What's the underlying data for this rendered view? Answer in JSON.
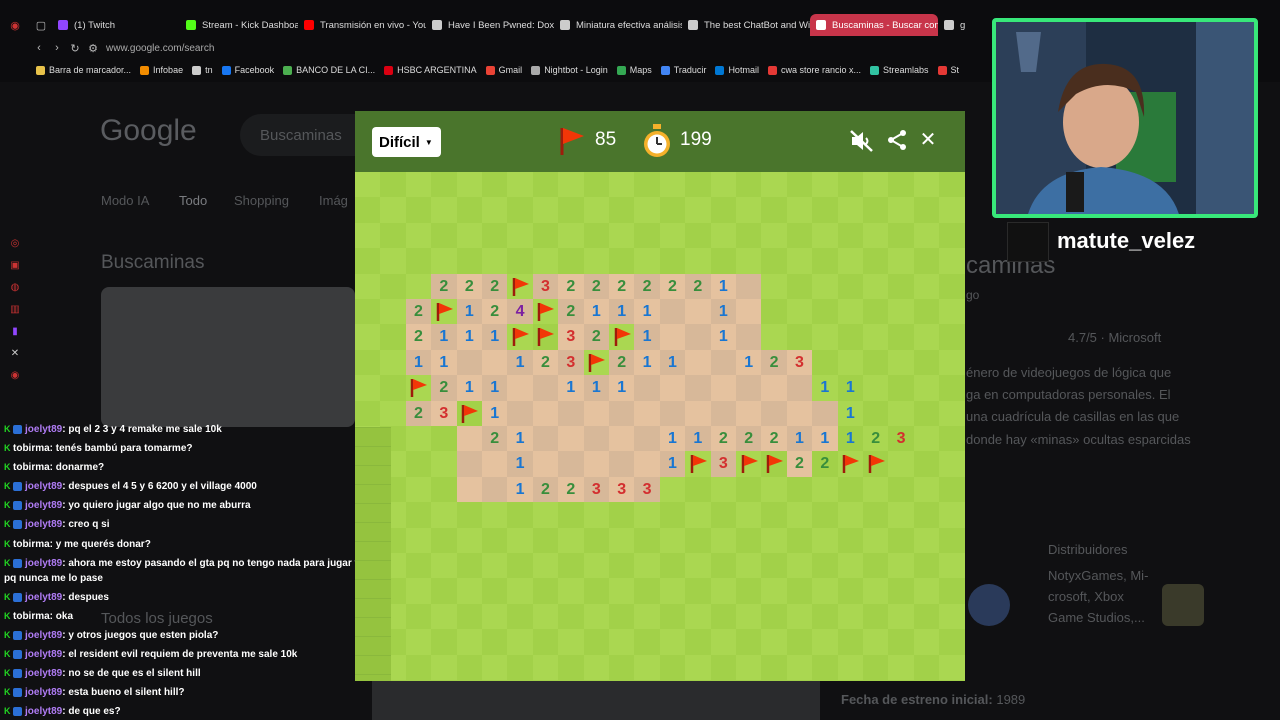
{
  "browser": {
    "tabs": [
      {
        "label": "(1) Twitch",
        "color": "#9146ff"
      },
      {
        "label": "Stream - Kick Dashboard",
        "color": "#53fc18"
      },
      {
        "label": "Transmisión en vivo - You",
        "color": "#ff0000"
      },
      {
        "label": "Have I Been Pwned: Doxb",
        "color": "#cccccc"
      },
      {
        "label": "Miniatura efectiva análisis",
        "color": "#cccccc"
      },
      {
        "label": "The best ChatBot and Wil",
        "color": "#cccccc"
      },
      {
        "label": "Buscaminas - Buscar con",
        "color": "#ffffff",
        "active": true
      },
      {
        "label": "g",
        "color": "#cccccc"
      }
    ],
    "url": "www.google.com/search",
    "bookmarks": [
      {
        "label": "Barra de marcador...",
        "color": "#e8c24a"
      },
      {
        "label": "Infobae",
        "color": "#f28c00"
      },
      {
        "label": "tn",
        "color": "#cccccc"
      },
      {
        "label": "Facebook",
        "color": "#1877f2"
      },
      {
        "label": "BANCO DE LA CI...",
        "color": "#4caf50"
      },
      {
        "label": "HSBC ARGENTINA",
        "color": "#db0011"
      },
      {
        "label": "Gmail",
        "color": "#ea4335"
      },
      {
        "label": "Nightbot - Login",
        "color": "#aaaaaa"
      },
      {
        "label": "Maps",
        "color": "#34a853"
      },
      {
        "label": "Traducir",
        "color": "#4285f4"
      },
      {
        "label": "Hotmail",
        "color": "#0078d4"
      },
      {
        "label": "cwa store rancio x...",
        "color": "#e53935"
      },
      {
        "label": "Streamlabs",
        "color": "#31c3a2"
      },
      {
        "label": "St",
        "color": "#e53935"
      }
    ]
  },
  "google": {
    "logo": "Google",
    "query": "Buscaminas",
    "tabs": [
      "Modo IA",
      "Todo",
      "Shopping",
      "Imág"
    ],
    "result_title": "Buscaminas",
    "kp_title": "caminas",
    "kp_sub": "go",
    "rating": "4.7/5 · Microsoft",
    "desc": [
      "énero de videojuegos de lógica que",
      "ga en computadoras personales. El",
      "una cuadrícula de casillas en las que",
      "donde hay «minas» ocultas esparcidas"
    ],
    "distrib_label": "Distribuidores",
    "distrib_text": [
      "NotyxGames, Mi-",
      "crosoft, Xbox",
      "Game Studios,..."
    ],
    "todos": "Todos los juegos",
    "fecha_label": "Fecha de estreno inicial:",
    "fecha_value": "1989"
  },
  "game": {
    "difficulty": "Difícil",
    "flags": "85",
    "timer": "199",
    "colors": {
      "header": "#4a752c",
      "grass_light": "#aad751",
      "grass_dark": "#a2d149",
      "dirt_light": "#e5c29f",
      "dirt_dark": "#d7b899",
      "flag": "#f23607"
    },
    "grid": [
      "..................................",
      "..................................",
      "..................................",
      "..................................",
      "...222F32222221...................",
      "..2F124F2111..1...................",
      "..2111FF32F1..1...................",
      "..11..123F211..123................",
      "..F211..111.......11..............",
      "..23F1.............1..............",
      ".....21.....1122211123............",
      "......1.....1F3FF22FF.............",
      "......122333......................",
      "..................................",
      "..................................",
      "..................................",
      "..................................",
      "..................................",
      "..................................",
      ".................................."
    ],
    "revealed": [
      "...ooooooooooooo..",
      "..oooooooooooooo..",
      "..oooooooooooooo..",
      "..oooooooooooooooo",
      "..oooooooooooooooo",
      "..ooooooooooooooooo",
      "....ooooooooooooooo",
      "....oooooooooooooo.",
      "....oooooooo......."
    ]
  },
  "chat": [
    {
      "user": "joelyt89",
      "text": ": pq el 2 3 y 4 remake me sale 10k",
      "badges": "ks",
      "ucls": "u1"
    },
    {
      "user": "tobirma",
      "text": ":         tenés bambú para tomarme?",
      "badges": "k",
      "ucls": "u2"
    },
    {
      "user": "tobirma",
      "text": ": donarme?",
      "badges": "k",
      "ucls": "u2"
    },
    {
      "user": "joelyt89",
      "text": ": despues el 4 5 y 6 6200 y el village 4000",
      "badges": "ks",
      "ucls": "u1"
    },
    {
      "user": "joelyt89",
      "text": ": yo quiero jugar algo que no me aburra",
      "badges": "ks",
      "ucls": "u1"
    },
    {
      "user": "joelyt89",
      "text": ": creo q si",
      "badges": "ks",
      "ucls": "u1"
    },
    {
      "user": "tobirma",
      "text": ": y me querés donar?",
      "badges": "k",
      "ucls": "u2"
    },
    {
      "user": "joelyt89",
      "text": ": ahora me estoy pasando el gta pq no tengo nada para jugar y pq nunca me lo pase",
      "badges": "ks",
      "ucls": "u1",
      "wrap": true
    },
    {
      "user": "joelyt89",
      "text": ": despues",
      "badges": "ks",
      "ucls": "u1"
    },
    {
      "user": "tobirma",
      "text": ": oka",
      "badges": "k",
      "ucls": "u2"
    },
    {
      "user": "joelyt89",
      "text": ": y otros juegos que esten piola?",
      "badges": "ks",
      "ucls": "u1"
    },
    {
      "user": "joelyt89",
      "text": ": el resident evil requiem de preventa me sale 10k",
      "badges": "ks",
      "ucls": "u1"
    },
    {
      "user": "joelyt89",
      "text": ": no se de que es el silent hill",
      "badges": "ks",
      "ucls": "u1"
    },
    {
      "user": "joelyt89",
      "text": ": esta bueno el silent hill?",
      "badges": "ks",
      "ucls": "u1"
    },
    {
      "user": "joelyt89",
      "text": ": de que es?",
      "badges": "ks",
      "ucls": "u1"
    }
  ],
  "streamer": {
    "name": "matute_velez",
    "border": "#38e87a"
  }
}
